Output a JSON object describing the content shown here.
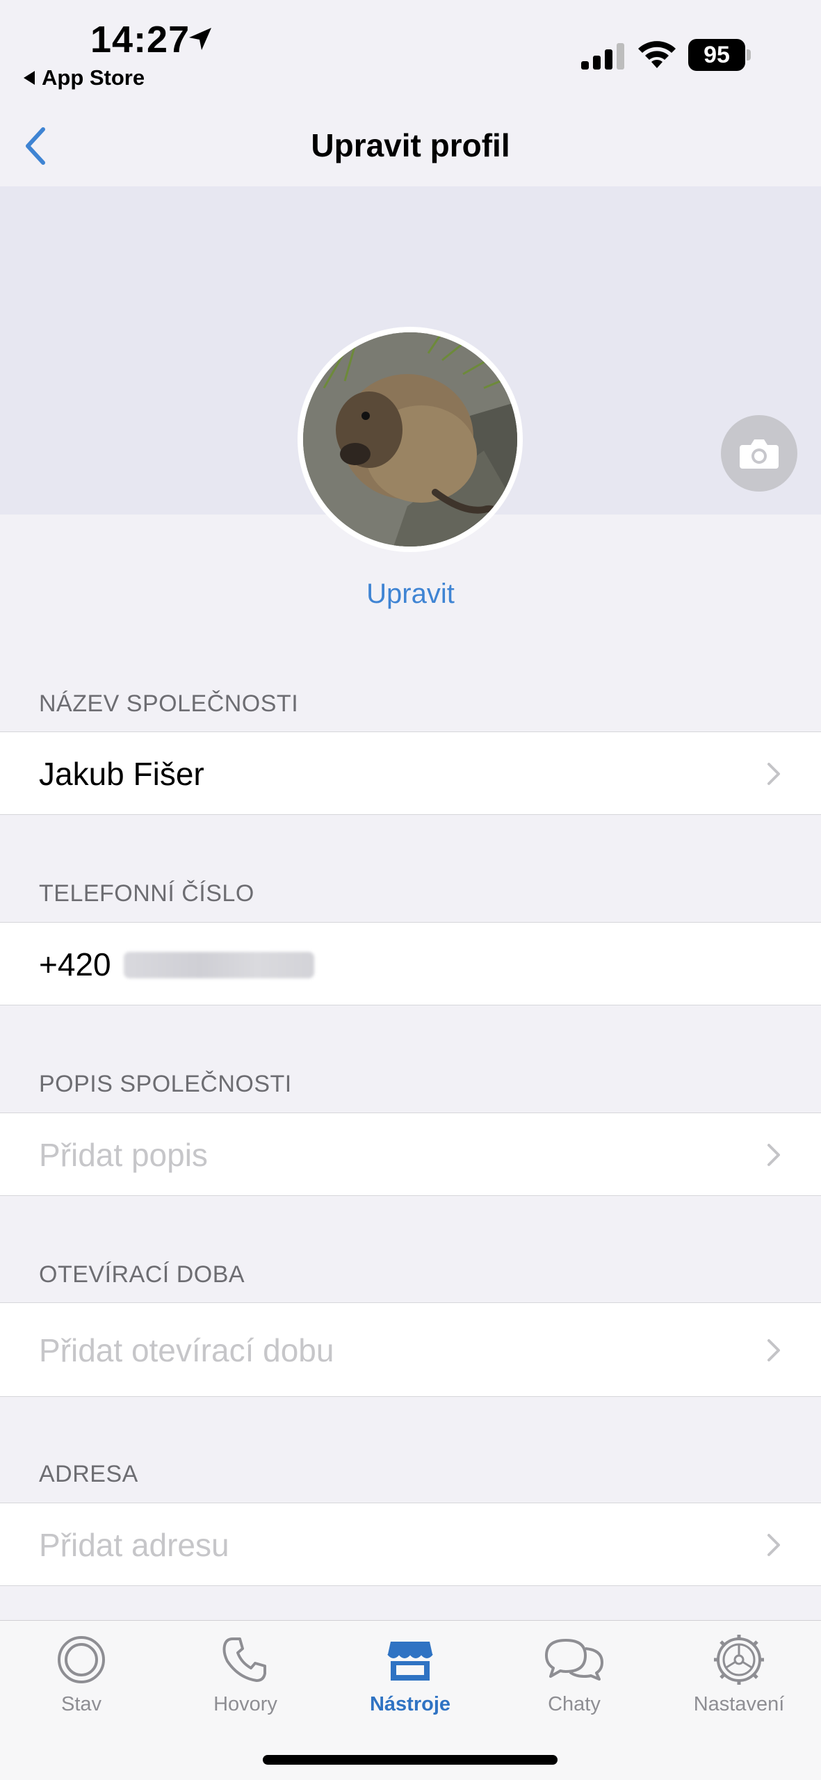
{
  "status_bar": {
    "time": "14:27",
    "back_app_label": "App Store",
    "battery_level": "95"
  },
  "nav": {
    "title": "Upravit profil"
  },
  "profile": {
    "edit_label": "Upravit"
  },
  "sections": {
    "company_name": {
      "label": "NÁZEV SPOLEČNOSTI",
      "value": "Jakub Fišer"
    },
    "phone": {
      "label": "TELEFONNÍ ČÍSLO",
      "prefix": "+420"
    },
    "description": {
      "label": "POPIS SPOLEČNOSTI",
      "placeholder": "Přidat popis"
    },
    "opening_hours": {
      "label": "OTEVÍRACÍ DOBA",
      "placeholder": "Přidat otevírací dobu"
    },
    "address": {
      "label": "ADRESA",
      "placeholder": "Přidat adresu"
    }
  },
  "tabbar": {
    "items": [
      {
        "label": "Stav",
        "icon": "status-ring-icon",
        "active": false
      },
      {
        "label": "Hovory",
        "icon": "phone-icon",
        "active": false
      },
      {
        "label": "Nástroje",
        "icon": "store-icon",
        "active": true
      },
      {
        "label": "Chaty",
        "icon": "chat-bubbles-icon",
        "active": false
      },
      {
        "label": "Nastavení",
        "icon": "gear-icon",
        "active": false
      }
    ]
  },
  "colors": {
    "accent": "#3f84d3",
    "tab_active": "#2f73c3",
    "background": "#f2f1f6",
    "header_band": "#e7e7f1",
    "section_label": "#6d6d72",
    "placeholder": "#c6c6c9"
  }
}
